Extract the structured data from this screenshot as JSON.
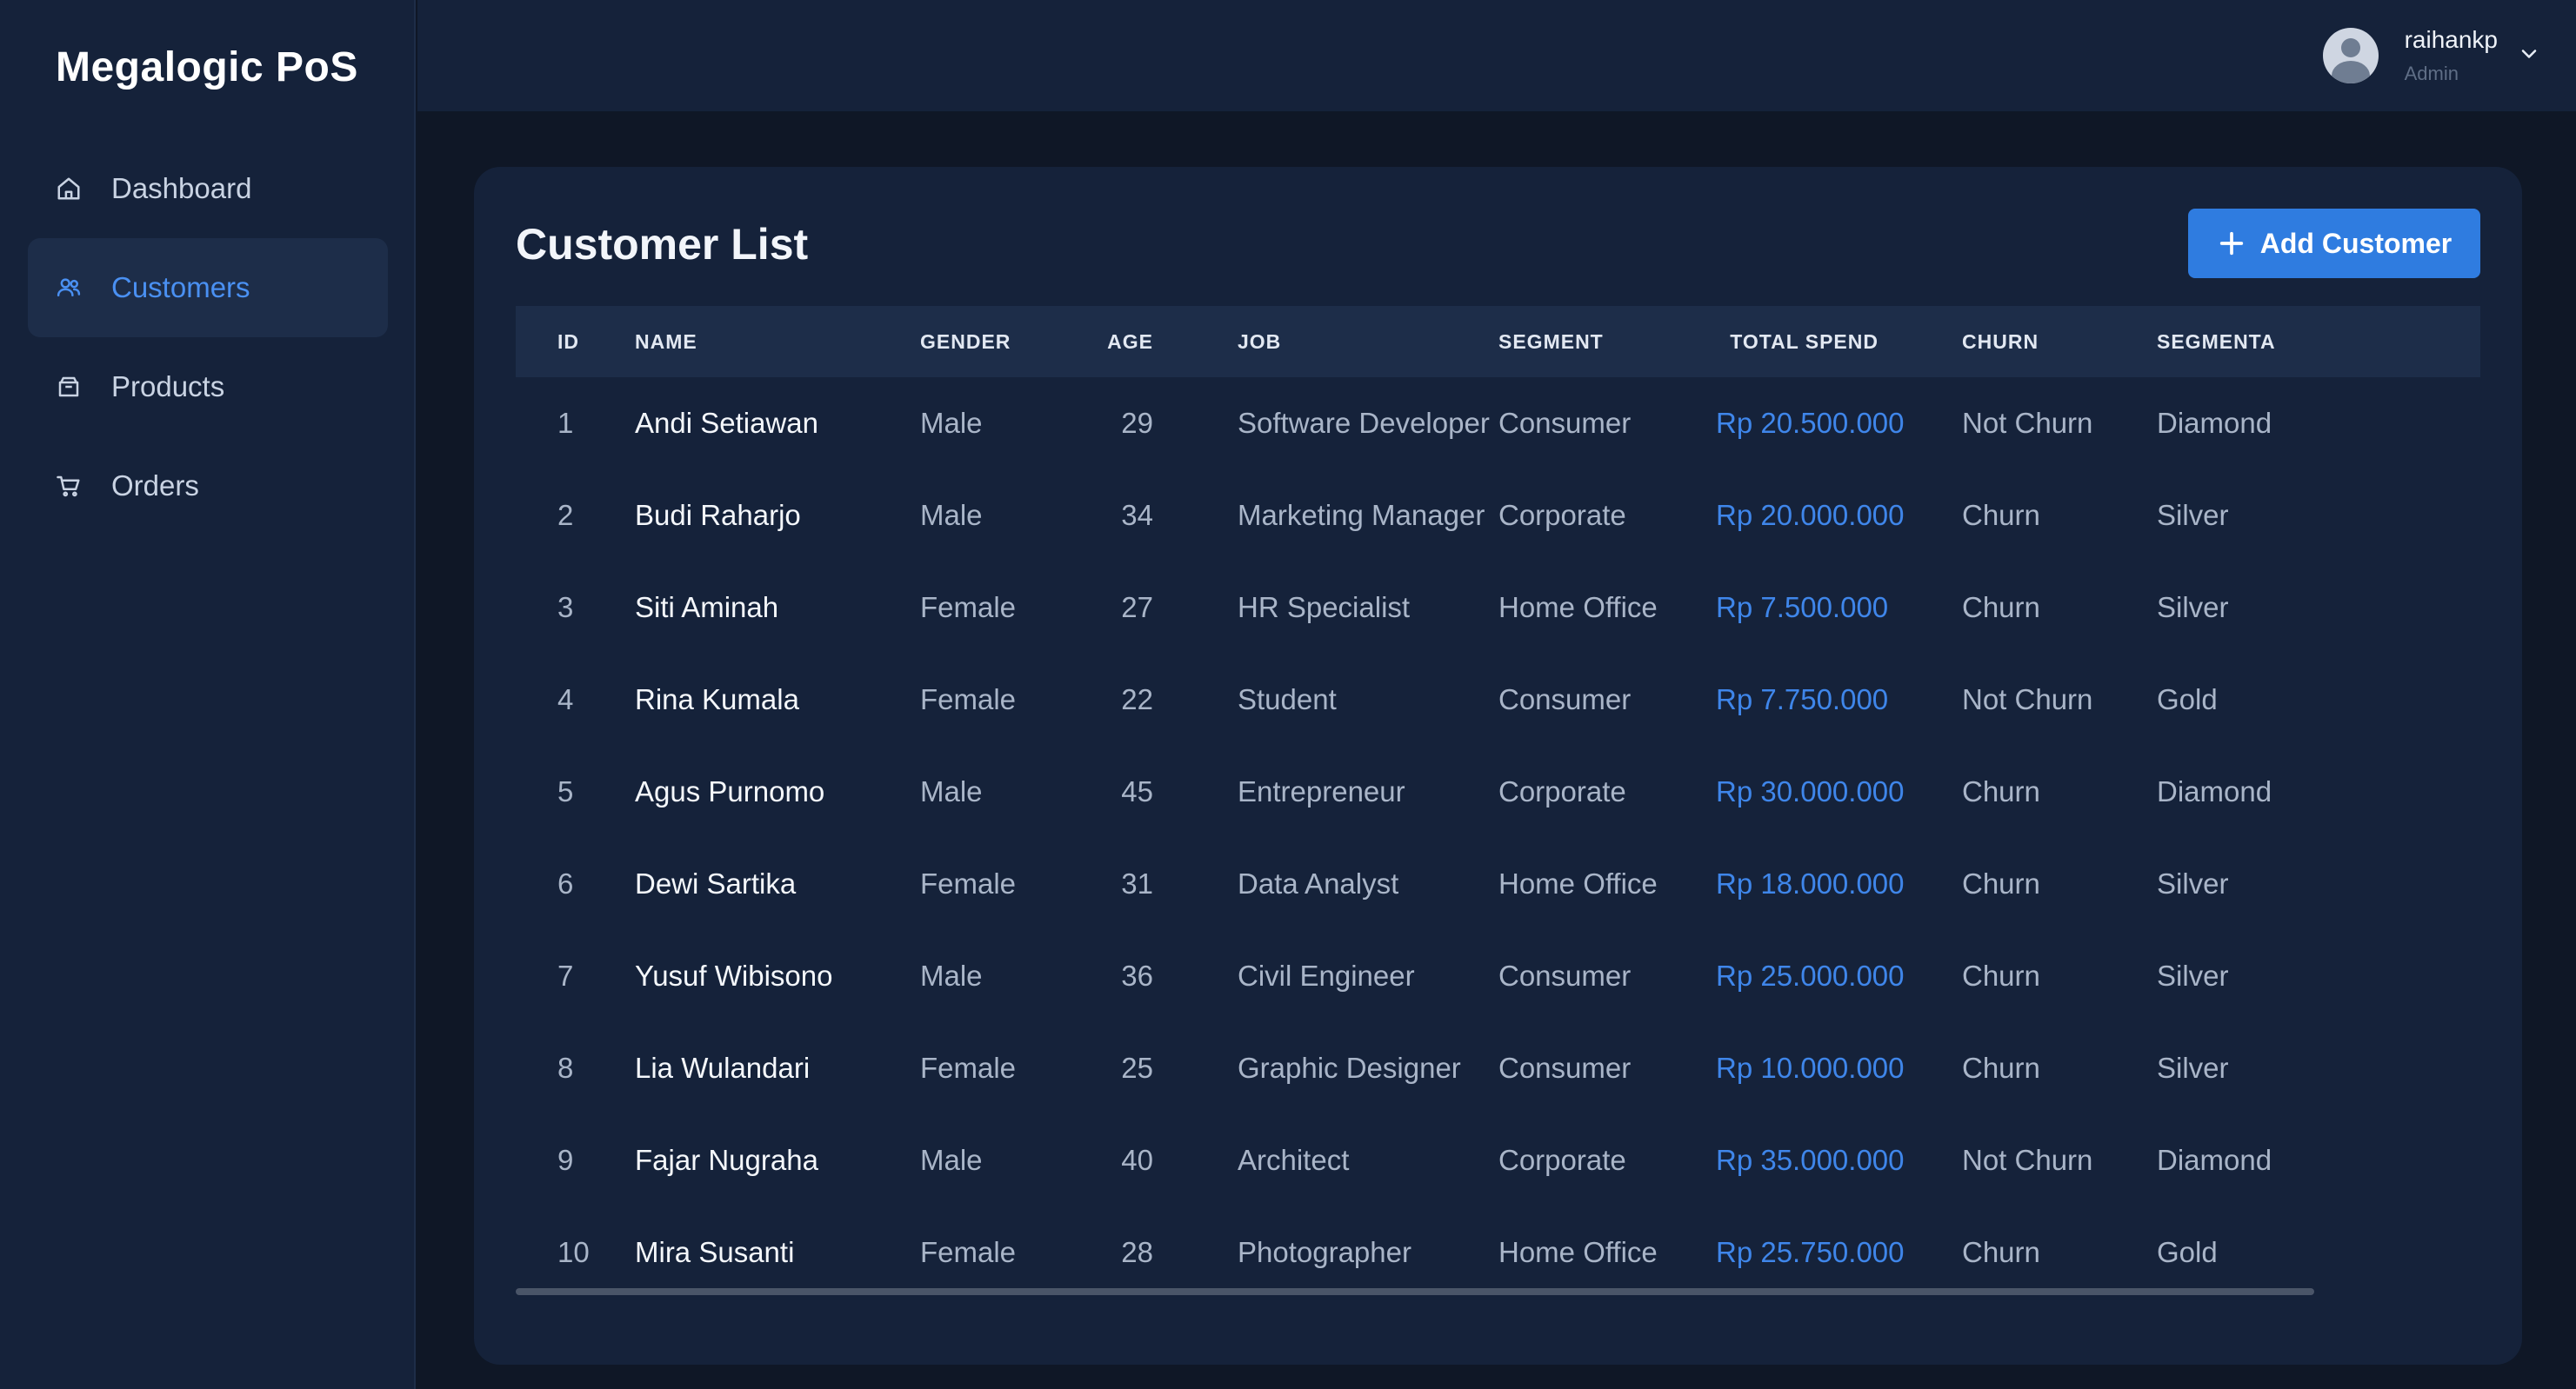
{
  "app": {
    "brand": "Megalogic PoS"
  },
  "sidebar": {
    "items": [
      {
        "label": "Dashboard",
        "icon": "home-icon"
      },
      {
        "label": "Customers",
        "icon": "users-icon"
      },
      {
        "label": "Products",
        "icon": "box-icon"
      },
      {
        "label": "Orders",
        "icon": "cart-icon"
      }
    ],
    "active": "Customers"
  },
  "header": {
    "user": {
      "name": "raihankp",
      "role": "Admin"
    }
  },
  "main": {
    "title": "Customer List",
    "add_button_label": "Add Customer",
    "table": {
      "columns": [
        "ID",
        "NAME",
        "GENDER",
        "AGE",
        "JOB",
        "SEGMENT",
        "TOTAL SPEND",
        "CHURN",
        "SEGMENTA"
      ],
      "rows": [
        {
          "id": "1",
          "name": "Andi Setiawan",
          "gender": "Male",
          "age": "29",
          "job": "Software Developer",
          "segment": "Consumer",
          "spend": "Rp 20.500.000",
          "churn": "Not Churn",
          "segmentation": "Diamond"
        },
        {
          "id": "2",
          "name": "Budi Raharjo",
          "gender": "Male",
          "age": "34",
          "job": "Marketing Manager",
          "segment": "Corporate",
          "spend": "Rp 20.000.000",
          "churn": "Churn",
          "segmentation": "Silver"
        },
        {
          "id": "3",
          "name": "Siti Aminah",
          "gender": "Female",
          "age": "27",
          "job": "HR Specialist",
          "segment": "Home Office",
          "spend": "Rp 7.500.000",
          "churn": "Churn",
          "segmentation": "Silver"
        },
        {
          "id": "4",
          "name": "Rina Kumala",
          "gender": "Female",
          "age": "22",
          "job": "Student",
          "segment": "Consumer",
          "spend": "Rp 7.750.000",
          "churn": "Not Churn",
          "segmentation": "Gold"
        },
        {
          "id": "5",
          "name": "Agus Purnomo",
          "gender": "Male",
          "age": "45",
          "job": "Entrepreneur",
          "segment": "Corporate",
          "spend": "Rp 30.000.000",
          "churn": "Churn",
          "segmentation": "Diamond"
        },
        {
          "id": "6",
          "name": "Dewi Sartika",
          "gender": "Female",
          "age": "31",
          "job": "Data Analyst",
          "segment": "Home Office",
          "spend": "Rp 18.000.000",
          "churn": "Churn",
          "segmentation": "Silver"
        },
        {
          "id": "7",
          "name": "Yusuf Wibisono",
          "gender": "Male",
          "age": "36",
          "job": "Civil Engineer",
          "segment": "Consumer",
          "spend": "Rp 25.000.000",
          "churn": "Churn",
          "segmentation": "Silver"
        },
        {
          "id": "8",
          "name": "Lia Wulandari",
          "gender": "Female",
          "age": "25",
          "job": "Graphic Designer",
          "segment": "Consumer",
          "spend": "Rp 10.000.000",
          "churn": "Churn",
          "segmentation": "Silver"
        },
        {
          "id": "9",
          "name": "Fajar Nugraha",
          "gender": "Male",
          "age": "40",
          "job": "Architect",
          "segment": "Corporate",
          "spend": "Rp 35.000.000",
          "churn": "Not Churn",
          "segmentation": "Diamond"
        },
        {
          "id": "10",
          "name": "Mira Susanti",
          "gender": "Female",
          "age": "28",
          "job": "Photographer",
          "segment": "Home Office",
          "spend": "Rp 25.750.000",
          "churn": "Churn",
          "segmentation": "Gold"
        }
      ]
    }
  },
  "colors": {
    "accent": "#3f86ea",
    "button": "#2f7ce0",
    "sidebar_bg": "#15223a",
    "page_bg": "#0f1726"
  }
}
